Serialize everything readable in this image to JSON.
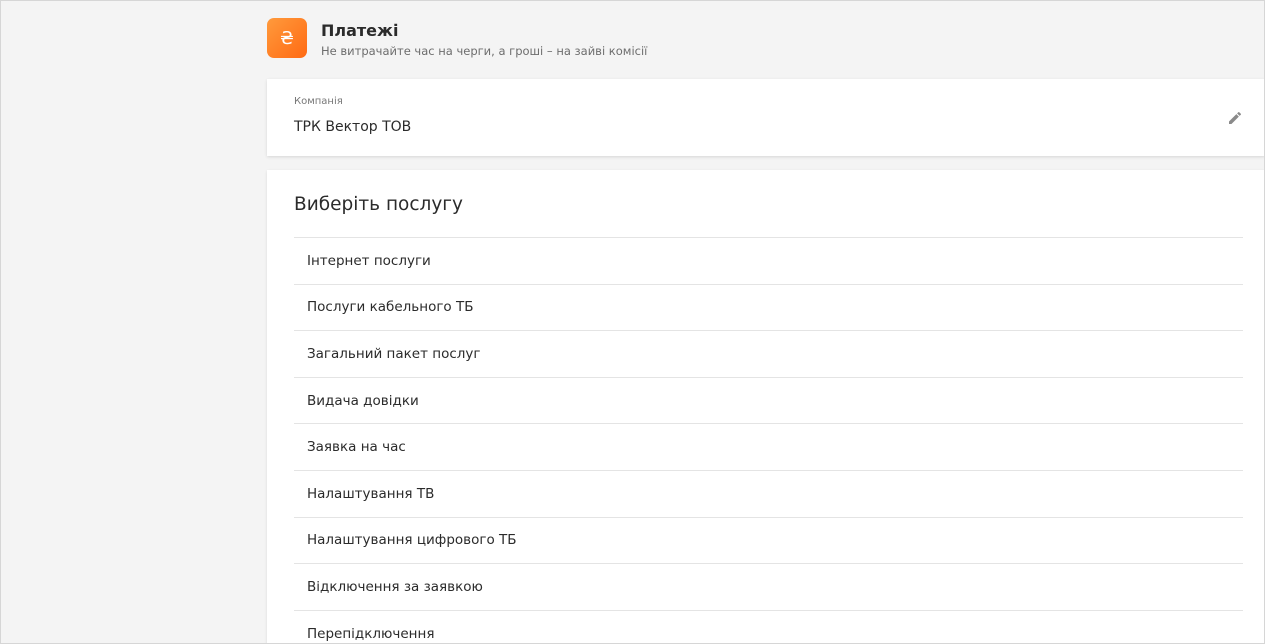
{
  "header": {
    "icon_glyph": "₴",
    "title": "Платежі",
    "subtitle": "Не витрачайте час на черги, а гроші – на зайві комісії"
  },
  "company": {
    "label": "Компанія",
    "name": "ТРК Вектор ТОВ"
  },
  "services": {
    "title": "Виберіть послугу",
    "items": [
      "Інтернет послуги",
      "Послуги кабельного ТБ",
      "Загальний пакет послуг",
      "Видача довідки",
      "Заявка на час",
      "Налаштування ТВ",
      "Налаштування цифрового ТБ",
      "Відключення за заявкою",
      "Перепідключення"
    ]
  },
  "colors": {
    "accent": "#ff7a1f",
    "background": "#f4f4f4",
    "card": "#ffffff"
  }
}
